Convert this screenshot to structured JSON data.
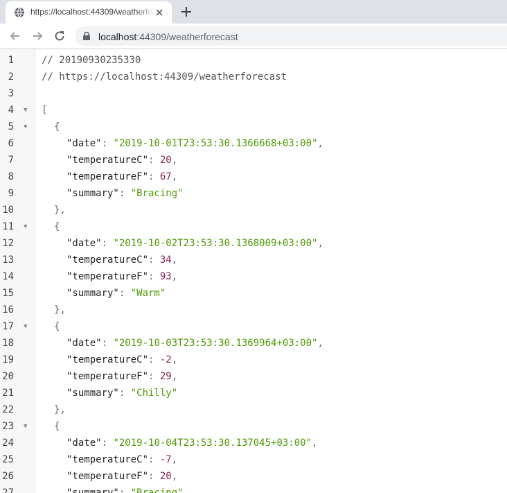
{
  "browser": {
    "tab_title": "https://localhost:44309/weatherforecast",
    "url_host": "localhost",
    "url_path": ":44309/weatherforecast"
  },
  "viewer": {
    "comment_timestamp": "// 20190930235330",
    "comment_url": "// https://localhost:44309/weatherforecast",
    "line_numbers": [
      "1",
      "2",
      "3",
      "4",
      "5",
      "6",
      "7",
      "8",
      "9",
      "10",
      "11",
      "12",
      "13",
      "14",
      "15",
      "16",
      "17",
      "18",
      "19",
      "20",
      "21",
      "22",
      "23",
      "24",
      "25",
      "26",
      "27"
    ],
    "open_bracket": "[",
    "open_brace": "{",
    "close_brace": "},",
    "keys": {
      "date": "\"date\"",
      "temperatureC": "\"temperatureC\"",
      "temperatureF": "\"temperatureF\"",
      "summary": "\"summary\""
    },
    "items": [
      {
        "date": "\"2019-10-01T23:53:30.1366668+03:00\"",
        "temperatureC": "20",
        "temperatureF": "67",
        "summary": "\"Bracing\""
      },
      {
        "date": "\"2019-10-02T23:53:30.1368009+03:00\"",
        "temperatureC": "34",
        "temperatureF": "93",
        "summary": "\"Warm\""
      },
      {
        "date": "\"2019-10-03T23:53:30.1369964+03:00\"",
        "temperatureC": "-2",
        "temperatureF": "29",
        "summary": "\"Chilly\""
      },
      {
        "date": "\"2019-10-04T23:53:30.137045+03:00\"",
        "temperatureC": "-7",
        "temperatureF": "20",
        "summary": "\"Bracing\""
      }
    ]
  }
}
